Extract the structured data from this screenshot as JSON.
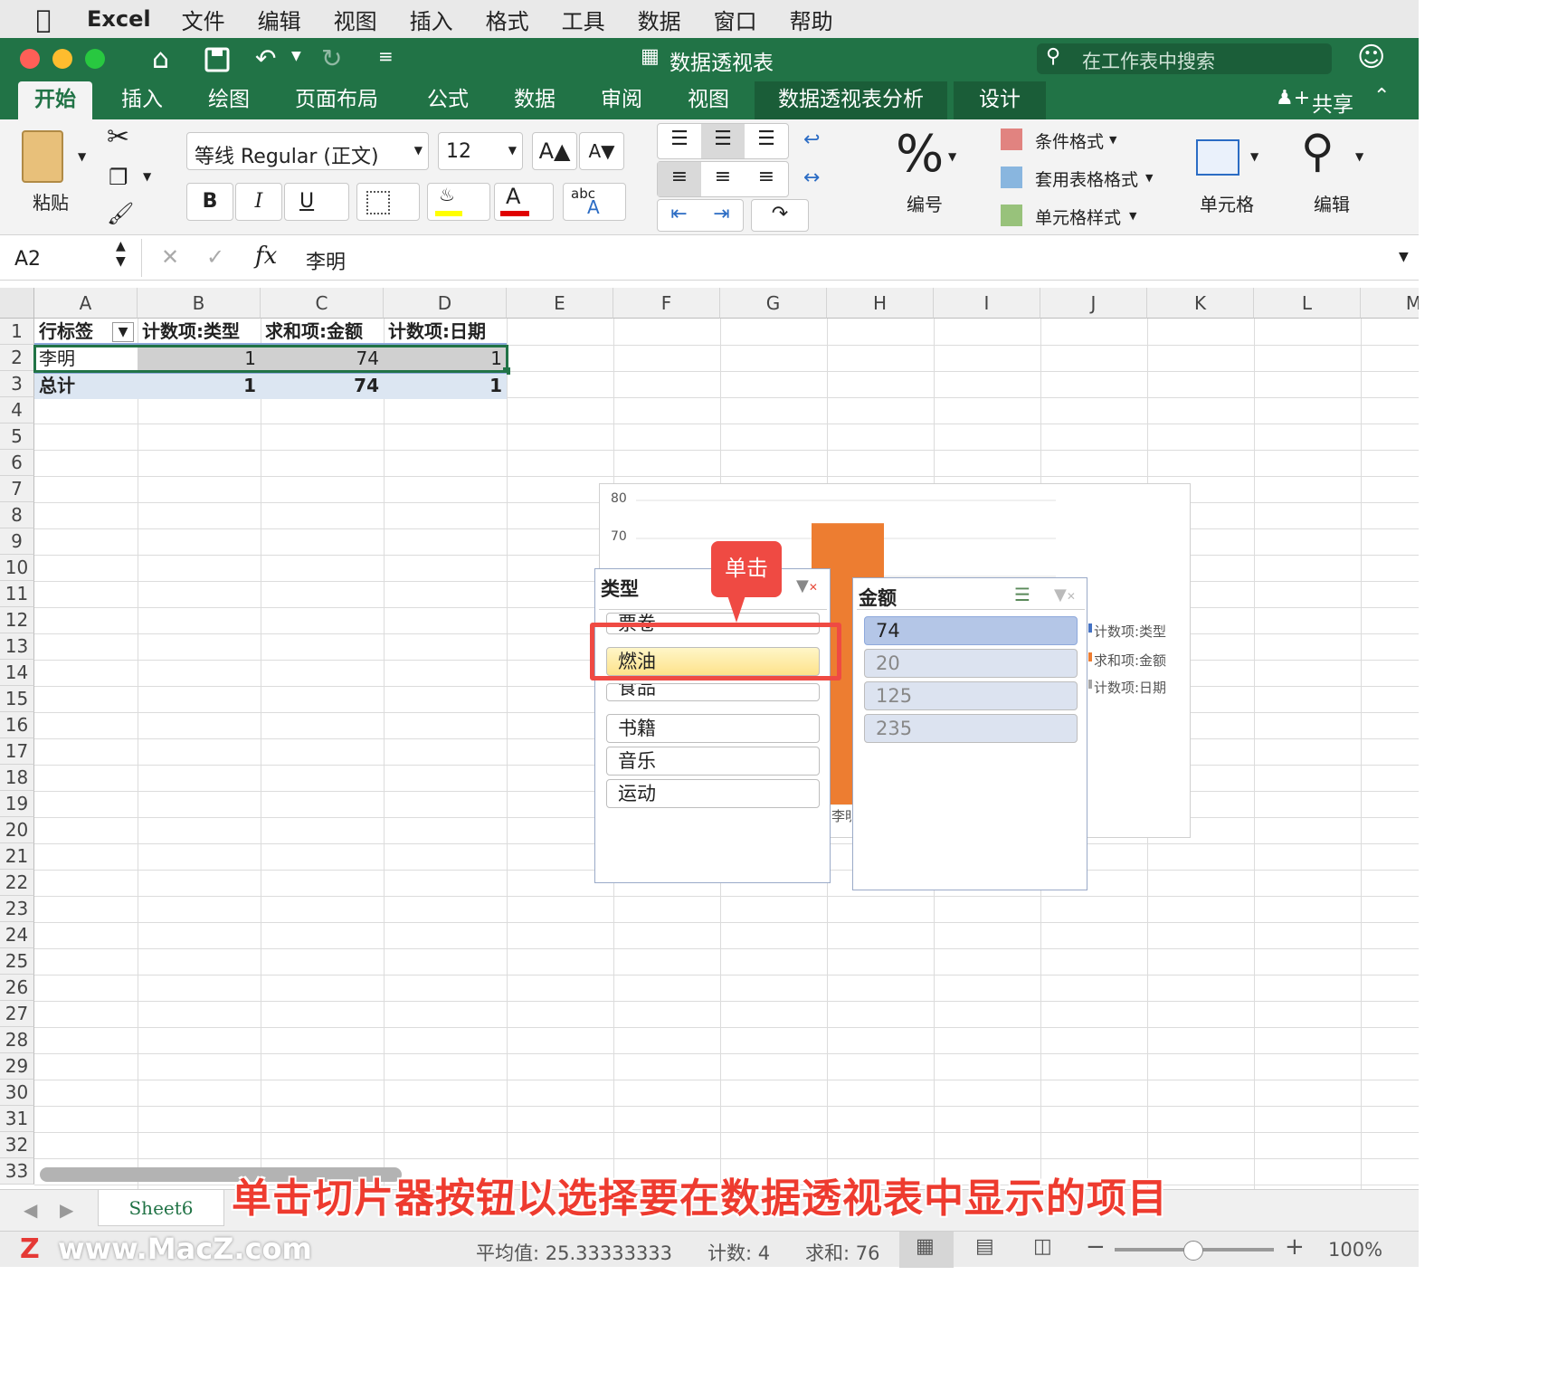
{
  "menubar": {
    "app": "Excel",
    "items": [
      "文件",
      "编辑",
      "视图",
      "插入",
      "格式",
      "工具",
      "数据",
      "窗口",
      "帮助"
    ]
  },
  "titlebar": {
    "doc_title": "数据透视表",
    "search_placeholder": "在工作表中搜索"
  },
  "tabs": {
    "home": "开始",
    "insert": "插入",
    "draw": "绘图",
    "layout": "页面布局",
    "formulas": "公式",
    "data": "数据",
    "review": "审阅",
    "view": "视图",
    "pivot_analyze": "数据透视表分析",
    "design": "设计",
    "share": "共享"
  },
  "ribbon": {
    "paste": "粘贴",
    "font_name": "等线 Regular (正文)",
    "font_size": "12",
    "bold": "B",
    "italic": "I",
    "underline": "U",
    "wrap_abc": "abc",
    "number_label": "编号",
    "cond_format": "条件格式",
    "table_format": "套用表格格式",
    "cell_style": "单元格样式",
    "cells_label": "单元格",
    "edit_label": "编辑"
  },
  "formula_bar": {
    "name_box": "A2",
    "fx": "fx",
    "value": "李明"
  },
  "columns": [
    "A",
    "B",
    "C",
    "D",
    "E",
    "F",
    "G",
    "H",
    "I",
    "J",
    "K",
    "L",
    "M"
  ],
  "rows": [
    "1",
    "2",
    "3",
    "4",
    "5",
    "6",
    "7",
    "8",
    "9",
    "10",
    "11",
    "12",
    "13",
    "14",
    "15",
    "16",
    "17",
    "18",
    "19",
    "20",
    "21",
    "22",
    "23",
    "24",
    "25",
    "26",
    "27",
    "28",
    "29",
    "30",
    "31",
    "32",
    "33"
  ],
  "pivot": {
    "headers": [
      "行标签",
      "计数项:类型",
      "求和项:金额",
      "计数项:日期"
    ],
    "row": [
      "李明",
      "1",
      "74",
      "1"
    ],
    "total": [
      "总计",
      "1",
      "74",
      "1"
    ]
  },
  "chart": {
    "y_ticks": [
      "80",
      "70"
    ],
    "legend": [
      "计数项:类型",
      "求和项:金额",
      "计数项:日期"
    ],
    "x_label_partial": "李明"
  },
  "chart_data": {
    "type": "bar",
    "categories": [
      "李明"
    ],
    "series": [
      {
        "name": "求和项:金额",
        "values": [
          74
        ]
      }
    ],
    "ylim": [
      0,
      80
    ]
  },
  "slicer_type": {
    "title": "类型",
    "items": [
      "票卷",
      "燃油",
      "食品",
      "书籍",
      "音乐",
      "运动"
    ]
  },
  "slicer_amount": {
    "title": "金额",
    "items": [
      "74",
      "20",
      "125",
      "235"
    ]
  },
  "callout": "单击",
  "caption": "单击切片器按钮以选择要在数据透视表中显示的项目",
  "sheet_tab": "Sheet6",
  "watermark": "www.MacZ.com",
  "status": {
    "average": "平均值: 25.33333333",
    "count": "计数: 4",
    "sum": "求和: 76",
    "zoom": "100%"
  },
  "colors": {
    "excel_green": "#217346",
    "bar_orange": "#ed7d31",
    "slicer_selected": "#b4c6e7",
    "highlight": "#e74c3c"
  }
}
